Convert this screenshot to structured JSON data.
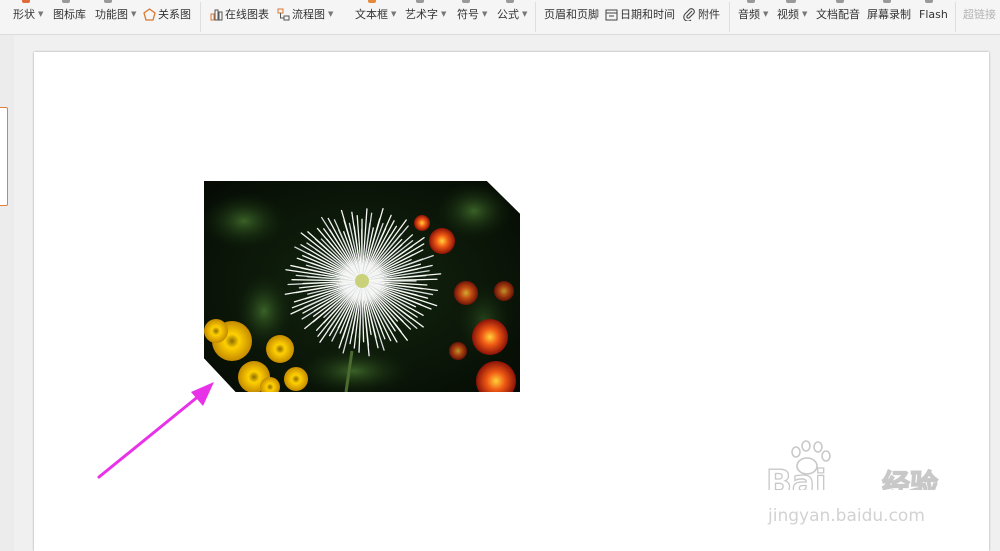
{
  "toolbar": {
    "items": [
      {
        "label": "形状",
        "icon": "shape-icon",
        "dropdown": true
      },
      {
        "label": "图标库",
        "icon": "icon-library-icon",
        "dropdown": false
      },
      {
        "label": "功能图",
        "icon": "function-chart-icon",
        "dropdown": true
      },
      {
        "label": "关系图",
        "icon": "relation-chart-icon",
        "dropdown": false
      },
      {
        "label": "在线图表",
        "icon": "online-chart-icon",
        "dropdown": false
      },
      {
        "label": "流程图",
        "icon": "flowchart-icon",
        "dropdown": true
      },
      {
        "label": "文本框",
        "icon": "textbox-icon",
        "dropdown": true
      },
      {
        "label": "艺术字",
        "icon": "wordart-icon",
        "dropdown": true
      },
      {
        "label": "符号",
        "icon": "symbol-icon",
        "dropdown": true
      },
      {
        "label": "公式",
        "icon": "formula-icon",
        "dropdown": true
      },
      {
        "label": "页眉和页脚",
        "icon": "header-footer-icon",
        "dropdown": false
      },
      {
        "label": "日期和时间",
        "icon": "calendar-icon",
        "dropdown": false
      },
      {
        "label": "附件",
        "icon": "paperclip-icon",
        "dropdown": false
      },
      {
        "label": "音频",
        "icon": "audio-icon",
        "dropdown": true
      },
      {
        "label": "视频",
        "icon": "video-icon",
        "dropdown": true
      },
      {
        "label": "文档配音",
        "icon": "dubbing-icon",
        "dropdown": false
      },
      {
        "label": "屏幕录制",
        "icon": "screen-record-icon",
        "dropdown": false
      },
      {
        "label": "Flash",
        "icon": "flash-icon",
        "dropdown": false
      },
      {
        "label": "超链接",
        "icon": "hyperlink-icon",
        "dropdown": false,
        "disabled": true
      }
    ]
  },
  "watermark": {
    "brand": "Bai",
    "brand_cn": "经验",
    "url": "jingyan.baidu.com"
  },
  "colors": {
    "arrow": "#e832e8",
    "selection_indicator": "#e0803a"
  }
}
